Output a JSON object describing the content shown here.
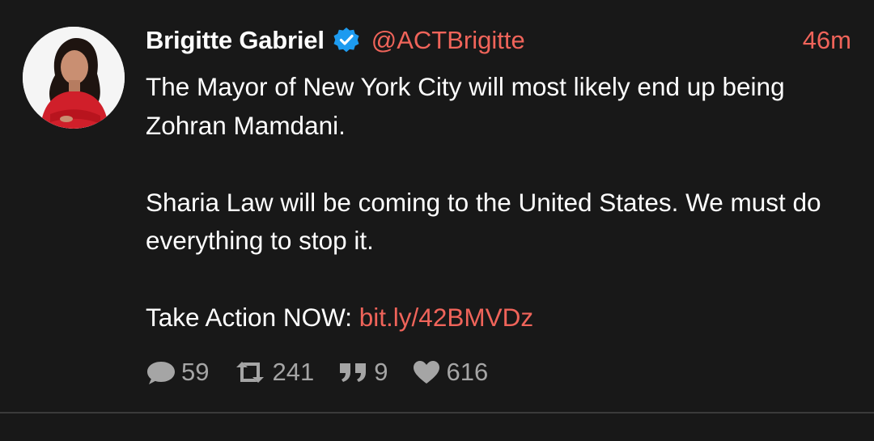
{
  "tweet": {
    "author": {
      "display_name": "Brigitte Gabriel",
      "handle": "@ACTBrigitte",
      "verified": true
    },
    "timestamp": "46m",
    "paragraphs": [
      "The Mayor of New York City will most likely end up being Zohran Mamdani.",
      "Sharia Law will be coming to the United States. We must do everything to stop it."
    ],
    "cta_text": "Take Action NOW: ",
    "cta_link": "bit.ly/42BMVDz",
    "stats": {
      "replies": "59",
      "retweets": "241",
      "quotes": "9",
      "likes": "616"
    }
  },
  "colors": {
    "background": "#181818",
    "accent": "#f0645a",
    "verified_blue": "#1d9bf0",
    "muted": "#a5a5a5"
  },
  "icons": [
    "verified-badge-icon",
    "reply-icon",
    "retweet-icon",
    "quote-icon",
    "like-icon"
  ]
}
